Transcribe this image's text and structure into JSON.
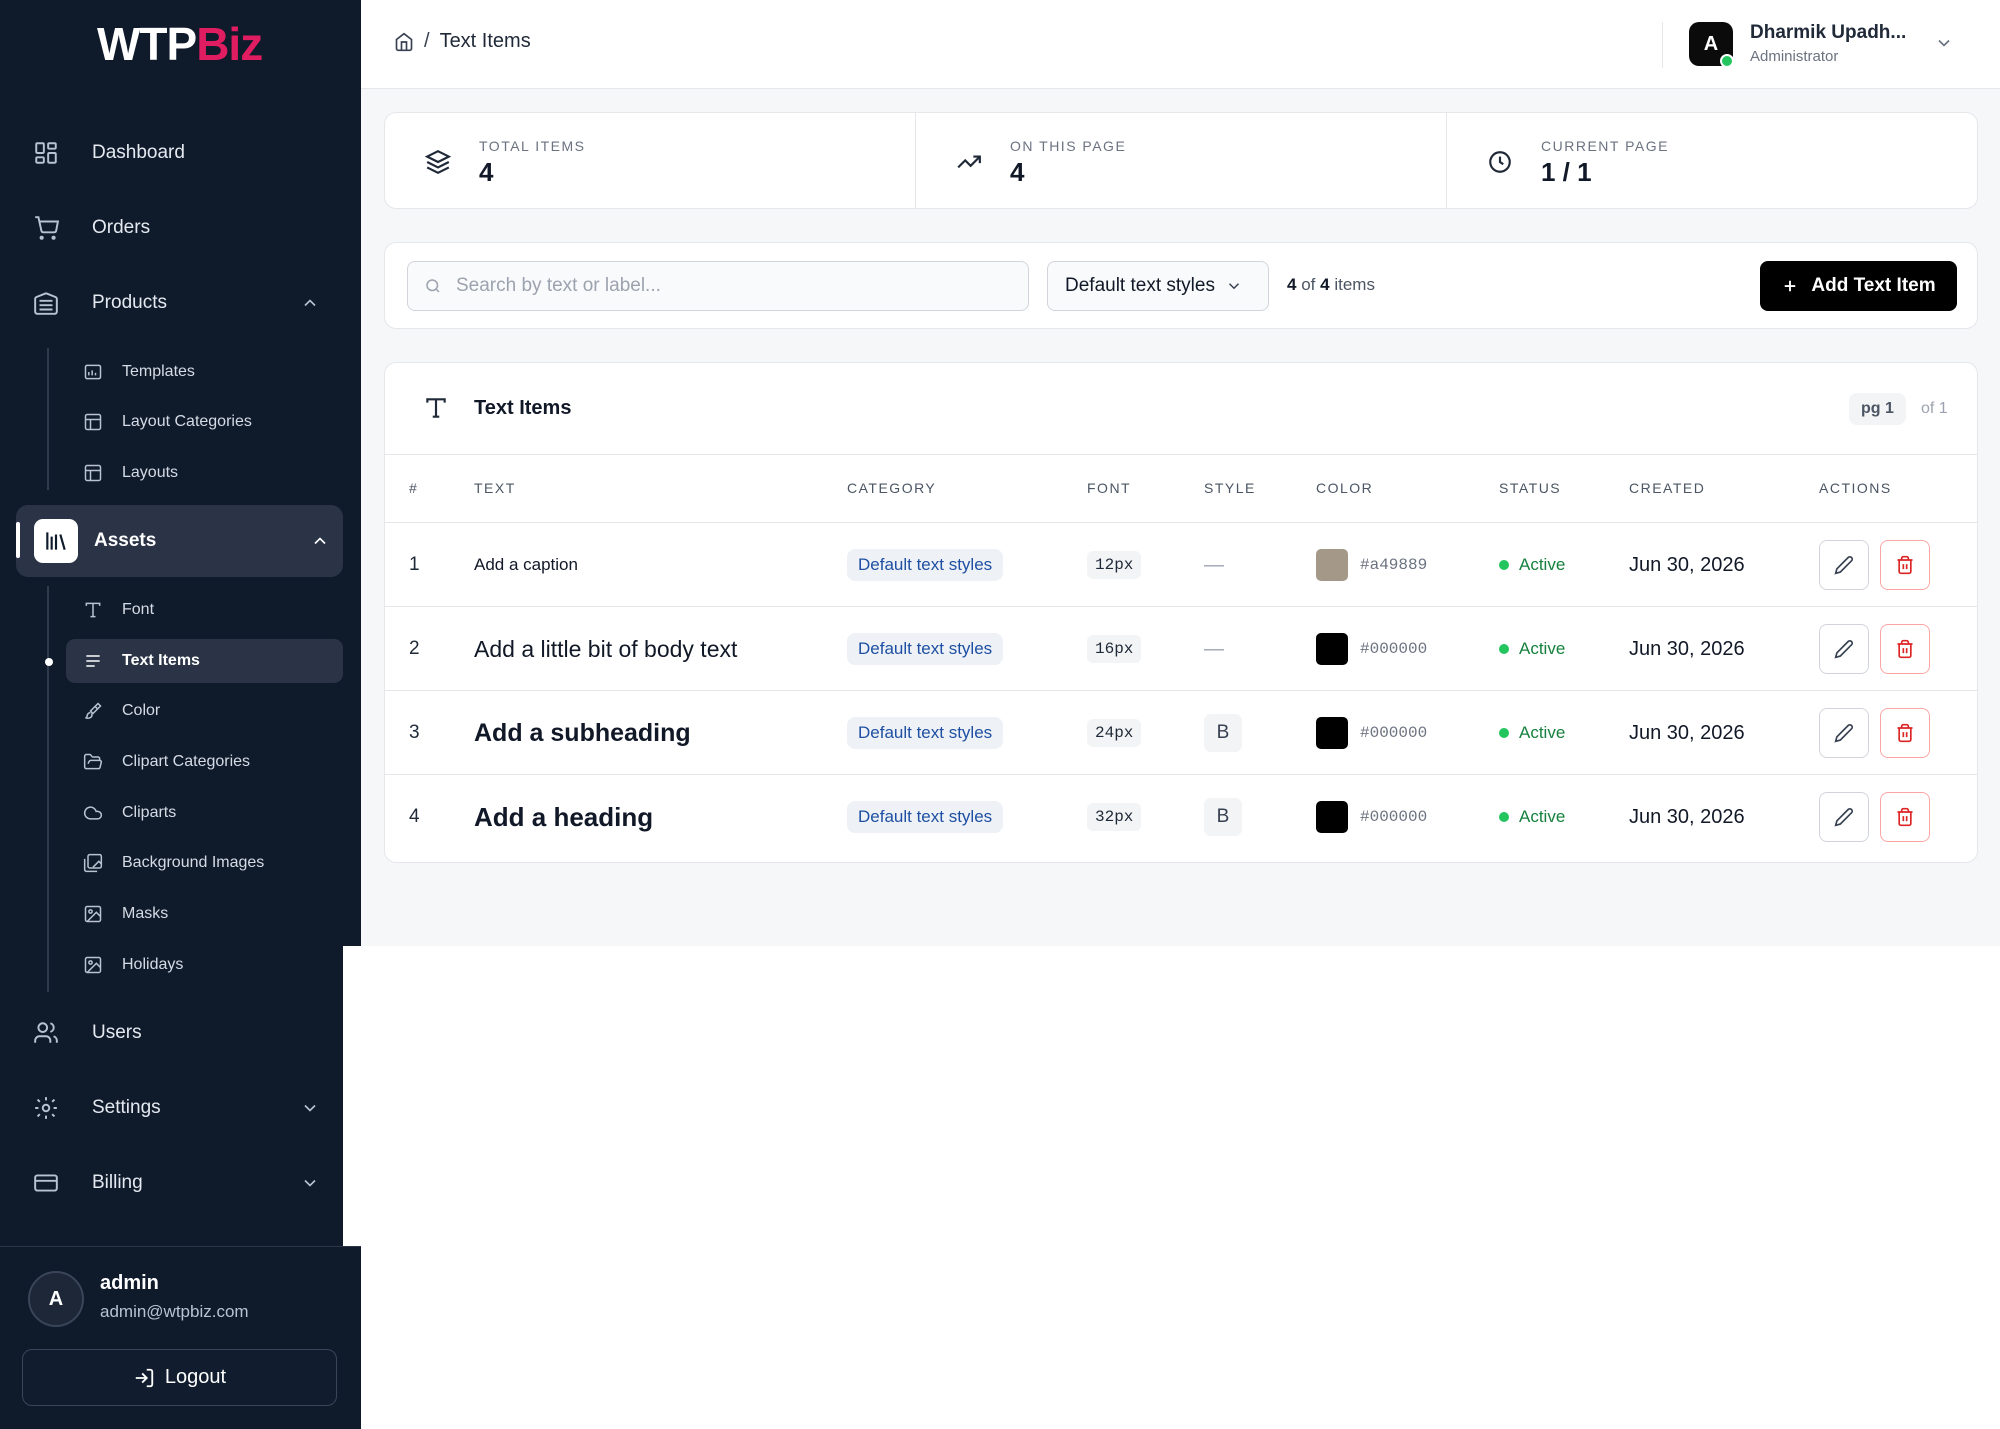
{
  "brand": {
    "part1": "WTP",
    "part2": "Biz"
  },
  "sidebar": {
    "items": [
      {
        "label": "Dashboard"
      },
      {
        "label": "Orders"
      },
      {
        "label": "Products"
      },
      {
        "label": "Assets"
      },
      {
        "label": "Users"
      },
      {
        "label": "Settings"
      },
      {
        "label": "Billing"
      }
    ],
    "products_sub": [
      {
        "label": "Templates"
      },
      {
        "label": "Layout Categories"
      },
      {
        "label": "Layouts"
      }
    ],
    "assets_sub": [
      {
        "label": "Font"
      },
      {
        "label": "Text Items"
      },
      {
        "label": "Color"
      },
      {
        "label": "Clipart Categories"
      },
      {
        "label": "Cliparts"
      },
      {
        "label": "Background Images"
      },
      {
        "label": "Masks"
      },
      {
        "label": "Holidays"
      }
    ],
    "footer": {
      "avatar": "A",
      "name": "admin",
      "email": "admin@wtpbiz.com",
      "logout": "Logout"
    }
  },
  "header": {
    "breadcrumb": {
      "sep": "/",
      "current": "Text Items"
    },
    "user": {
      "avatar": "A",
      "name": "Dharmik Upadh...",
      "role": "Administrator"
    }
  },
  "stats": [
    {
      "label": "TOTAL ITEMS",
      "value": "4"
    },
    {
      "label": "ON THIS PAGE",
      "value": "4"
    },
    {
      "label": "CURRENT PAGE",
      "value": "1 / 1"
    }
  ],
  "filters": {
    "search_placeholder": "Search by text or label...",
    "category_selected": "Default text styles",
    "count_shown": "4",
    "count_of": "of",
    "count_total": "4",
    "count_suffix": "items",
    "add_label": "Add Text Item"
  },
  "table": {
    "title": "Text Items",
    "page_badge": "pg 1",
    "page_of": "of 1",
    "columns": [
      "#",
      "TEXT",
      "CATEGORY",
      "FONT",
      "STYLE",
      "COLOR",
      "STATUS",
      "CREATED",
      "ACTIONS"
    ],
    "rows": [
      {
        "num": "1",
        "text": "Add a caption",
        "category": "Default text styles",
        "font": "12px",
        "style": "—",
        "color": "#a49889",
        "hex": "#a49889",
        "status": "Active",
        "created": "Jun 30, 2026"
      },
      {
        "num": "2",
        "text": "Add a little bit of body text",
        "category": "Default text styles",
        "font": "16px",
        "style": "—",
        "color": "#000000",
        "hex": "#000000",
        "status": "Active",
        "created": "Jun 30, 2026"
      },
      {
        "num": "3",
        "text": "Add a subheading",
        "category": "Default text styles",
        "font": "24px",
        "style": "B",
        "color": "#000000",
        "hex": "#000000",
        "status": "Active",
        "created": "Jun 30, 2026"
      },
      {
        "num": "4",
        "text": "Add a heading",
        "category": "Default text styles",
        "font": "32px",
        "style": "B",
        "color": "#000000",
        "hex": "#000000",
        "status": "Active",
        "created": "Jun 30, 2026"
      }
    ]
  }
}
